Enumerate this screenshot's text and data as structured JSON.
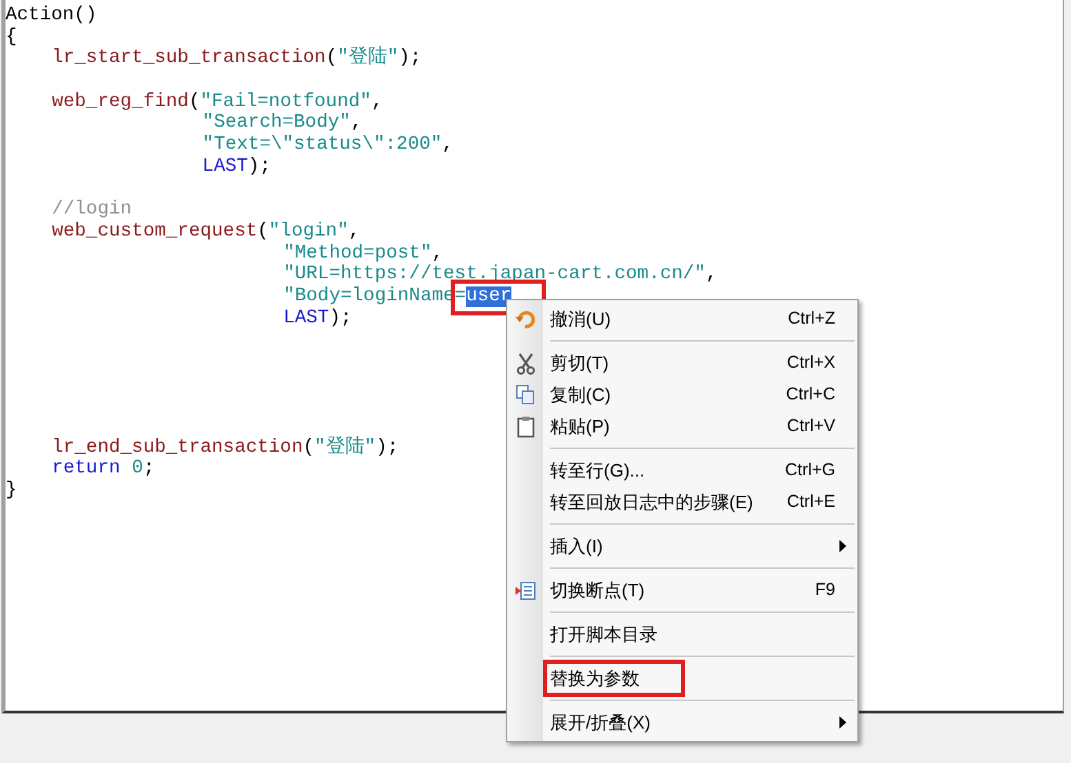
{
  "editor": {
    "lines": [
      {
        "kind": "top",
        "tokens": [
          {
            "kind": "plain",
            "text": "Action()"
          }
        ]
      },
      {
        "kind": "top",
        "tokens": [
          {
            "kind": "plain",
            "text": "{"
          }
        ]
      },
      {
        "kind": "stmt",
        "tokens": [
          {
            "kind": "func",
            "text": "lr_start_sub_transaction"
          },
          {
            "kind": "plain",
            "text": "("
          },
          {
            "kind": "str",
            "text": "\"登陆\""
          },
          {
            "kind": "plain",
            "text": ");"
          }
        ]
      },
      {
        "kind": "blank"
      },
      {
        "kind": "stmt",
        "tokens": [
          {
            "kind": "func",
            "text": "web_reg_find"
          },
          {
            "kind": "plain",
            "text": "("
          },
          {
            "kind": "str",
            "text": "\"Fail=notfound\""
          },
          {
            "kind": "plain",
            "text": ","
          }
        ]
      },
      {
        "kind": "arg_short",
        "tokens": [
          {
            "kind": "str",
            "text": "\"Search=Body\""
          },
          {
            "kind": "plain",
            "text": ","
          }
        ]
      },
      {
        "kind": "arg_short",
        "tokens": [
          {
            "kind": "str",
            "text": "\"Text=\\\"status\\\":200\""
          },
          {
            "kind": "plain",
            "text": ","
          }
        ]
      },
      {
        "kind": "arg_short",
        "tokens": [
          {
            "kind": "kw",
            "text": "LAST"
          },
          {
            "kind": "plain",
            "text": ");"
          }
        ]
      },
      {
        "kind": "blank"
      },
      {
        "kind": "stmt",
        "tokens": [
          {
            "kind": "comment",
            "text": "//login"
          }
        ]
      },
      {
        "kind": "stmt",
        "tokens": [
          {
            "kind": "func",
            "text": "web_custom_request"
          },
          {
            "kind": "plain",
            "text": "("
          },
          {
            "kind": "str",
            "text": "\"login\""
          },
          {
            "kind": "plain",
            "text": ","
          }
        ]
      },
      {
        "kind": "arg_long",
        "tokens": [
          {
            "kind": "str",
            "text": "\"Method=post\""
          },
          {
            "kind": "plain",
            "text": ","
          }
        ]
      },
      {
        "kind": "arg_long",
        "tokens": [
          {
            "kind": "str",
            "text": "\"URL=https://test.japan-cart.com.cn/\""
          },
          {
            "kind": "plain",
            "text": ","
          }
        ]
      },
      {
        "kind": "arg_long",
        "tokens": [
          {
            "kind": "str",
            "text": "\"Body=loginName="
          },
          {
            "kind": "selected",
            "text": "user",
            "annotated": true
          }
        ]
      },
      {
        "kind": "arg_long",
        "tokens": [
          {
            "kind": "kw",
            "text": "LAST"
          },
          {
            "kind": "plain",
            "text": ");"
          }
        ]
      },
      {
        "kind": "blank"
      },
      {
        "kind": "blank"
      },
      {
        "kind": "blank"
      },
      {
        "kind": "blank"
      },
      {
        "kind": "blank"
      },
      {
        "kind": "stmt",
        "tokens": [
          {
            "kind": "func",
            "text": "lr_end_sub_transaction"
          },
          {
            "kind": "plain",
            "text": "("
          },
          {
            "kind": "str",
            "text": "\"登陆\""
          },
          {
            "kind": "plain",
            "text": ");"
          }
        ]
      },
      {
        "kind": "stmt",
        "tokens": [
          {
            "kind": "kw",
            "text": "return"
          },
          {
            "kind": "str",
            "text": "0"
          },
          {
            "kind": "plain",
            "text": ";"
          }
        ]
      },
      {
        "kind": "top",
        "tokens": [
          {
            "kind": "plain",
            "text": "}"
          }
        ]
      }
    ]
  },
  "context_menu": {
    "items": [
      {
        "kind": "undo",
        "label": "撤消(U)",
        "shortcut": "Ctrl+Z"
      },
      {
        "kind": "separator"
      },
      {
        "kind": "cut",
        "label": "剪切(T)",
        "shortcut": "Ctrl+X"
      },
      {
        "kind": "copy",
        "label": "复制(C)",
        "shortcut": "Ctrl+C"
      },
      {
        "kind": "paste",
        "label": "粘贴(P)",
        "shortcut": "Ctrl+V"
      },
      {
        "kind": "separator"
      },
      {
        "kind": "item",
        "label": "转至行(G)...",
        "shortcut": "Ctrl+G"
      },
      {
        "kind": "item",
        "label": "转至回放日志中的步骤(E)",
        "shortcut": "Ctrl+E"
      },
      {
        "kind": "separator"
      },
      {
        "kind": "submenu",
        "label": "插入(I)"
      },
      {
        "kind": "separator"
      },
      {
        "kind": "breakpoint",
        "label": "切换断点(T)",
        "shortcut": "F9"
      },
      {
        "kind": "separator"
      },
      {
        "kind": "item",
        "label": "打开脚本目录"
      },
      {
        "kind": "separator"
      },
      {
        "kind": "item",
        "label": "替换为参数",
        "annotated": true
      },
      {
        "kind": "separator"
      },
      {
        "kind": "submenu",
        "label": "展开/折叠(X)"
      }
    ]
  }
}
